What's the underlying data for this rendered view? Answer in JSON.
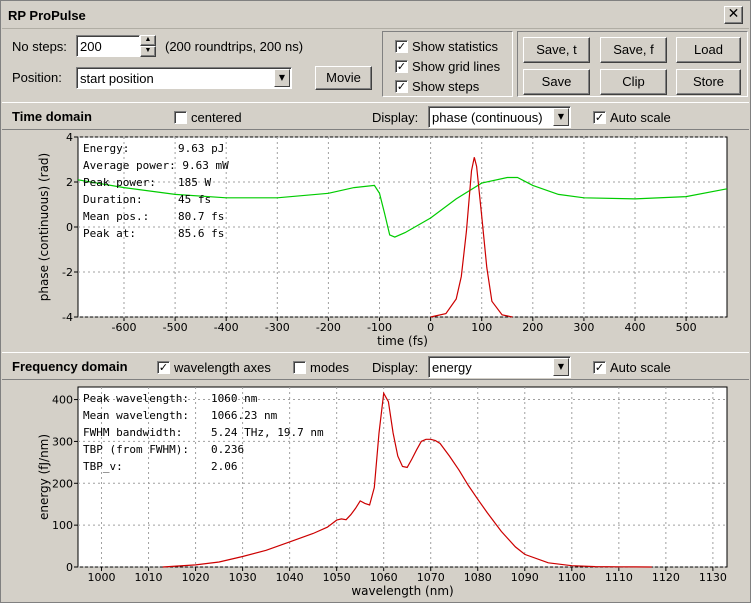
{
  "window": {
    "title": "RP ProPulse",
    "close_glyph": "✕"
  },
  "controls": {
    "no_steps_label": "No steps:",
    "no_steps_value": "200",
    "no_steps_info": "(200 roundtrips, 200 ns)",
    "position_label": "Position:",
    "position_value": "start position",
    "movie_button": "Movie",
    "show_statistics": {
      "label": "Show statistics",
      "checked": true
    },
    "show_grid_lines": {
      "label": "Show grid lines",
      "checked": true
    },
    "show_steps": {
      "label": "Show steps",
      "checked": true
    },
    "buttons": {
      "save_t": "Save, t",
      "save_f": "Save, f",
      "load": "Load",
      "save": "Save",
      "clip": "Clip",
      "store": "Store"
    }
  },
  "time_domain": {
    "title": "Time domain",
    "centered_label": "centered",
    "display_label": "Display:",
    "display_value": "phase (continuous)",
    "auto_scale_label": "Auto scale",
    "stats": [
      {
        "k": "Energy:",
        "v": "9.63 pJ"
      },
      {
        "k": "Average power:",
        "v": "9.63 mW"
      },
      {
        "k": "Peak power:",
        "v": "185 W"
      },
      {
        "k": "Duration:",
        "v": "45 fs"
      },
      {
        "k": "Mean pos.:",
        "v": "80.7 fs"
      },
      {
        "k": "Peak at:",
        "v": "85.6 fs"
      }
    ]
  },
  "frequency_domain": {
    "title": "Frequency domain",
    "wavelength_axes_label": "wavelength axes",
    "modes_label": "modes",
    "display_label": "Display:",
    "display_value": "energy",
    "auto_scale_label": "Auto scale",
    "stats": [
      {
        "k": "Peak wavelength:",
        "v": "1060 nm"
      },
      {
        "k": "Mean wavelength:",
        "v": "1066.23 nm"
      },
      {
        "k": "FWHM bandwidth:",
        "v": "5.24 THz, 19.7 nm"
      },
      {
        "k": "TBP (from FWHM):",
        "v": "0.236"
      },
      {
        "k": "TBP_v:",
        "v": "2.06"
      }
    ]
  },
  "chart_data": [
    {
      "type": "line",
      "xlabel": "time (fs)",
      "ylabel": "phase (continuous) (rad)",
      "xlim": [
        -690,
        580
      ],
      "ylim": [
        -4,
        4
      ],
      "x_ticks": [
        -600,
        -500,
        -400,
        -300,
        -200,
        -100,
        0,
        100,
        200,
        300,
        400,
        500
      ],
      "y_ticks": [
        -4,
        -2,
        0,
        2,
        4
      ],
      "grid": true,
      "series": [
        {
          "color": "#00cc00",
          "x": [
            -690,
            -600,
            -500,
            -400,
            -300,
            -200,
            -150,
            -110,
            -100,
            -90,
            -80,
            -70,
            -50,
            0,
            50,
            100,
            150,
            170,
            200,
            250,
            300,
            400,
            500,
            580
          ],
          "y": [
            2.1,
            1.75,
            1.45,
            1.3,
            1.3,
            1.5,
            1.75,
            1.85,
            1.5,
            0.6,
            -0.35,
            -0.45,
            -0.25,
            0.4,
            1.25,
            1.95,
            2.2,
            2.2,
            1.85,
            1.45,
            1.3,
            1.25,
            1.35,
            1.7
          ]
        },
        {
          "color": "#cc0000",
          "x": [
            0,
            30,
            50,
            60,
            70,
            80,
            85.6,
            90,
            100,
            110,
            120,
            140,
            160
          ],
          "y": [
            -4,
            -3.85,
            -3.2,
            -2.2,
            -0.2,
            2.5,
            3.1,
            2.7,
            0.5,
            -1.8,
            -3.3,
            -3.9,
            -4
          ]
        }
      ]
    },
    {
      "type": "line",
      "xlabel": "wavelength (nm)",
      "ylabel": "energy (fJ/nm)",
      "xlim": [
        995,
        1133
      ],
      "ylim": [
        0,
        430
      ],
      "x_ticks": [
        1000,
        1010,
        1020,
        1030,
        1040,
        1050,
        1060,
        1070,
        1080,
        1090,
        1100,
        1110,
        1120,
        1130
      ],
      "y_ticks": [
        0,
        100,
        200,
        300,
        400
      ],
      "grid": true,
      "series": [
        {
          "color": "#cc0000",
          "x": [
            1013,
            1020,
            1025,
            1030,
            1035,
            1040,
            1045,
            1048,
            1050,
            1051,
            1052,
            1053,
            1054,
            1055,
            1056,
            1057,
            1058,
            1059,
            1060,
            1061,
            1062,
            1063,
            1064,
            1065,
            1066,
            1067,
            1068,
            1069,
            1070,
            1071,
            1072,
            1074,
            1076,
            1078,
            1080,
            1082,
            1085,
            1088,
            1090,
            1095,
            1100,
            1105,
            1110,
            1117
          ],
          "y": [
            0,
            5,
            12,
            25,
            40,
            60,
            80,
            95,
            112,
            115,
            113,
            125,
            140,
            158,
            152,
            148,
            190,
            320,
            415,
            395,
            320,
            265,
            240,
            238,
            258,
            280,
            300,
            305,
            305,
            302,
            295,
            265,
            232,
            195,
            162,
            130,
            85,
            48,
            30,
            10,
            3,
            1,
            0.5,
            0
          ]
        }
      ]
    }
  ]
}
